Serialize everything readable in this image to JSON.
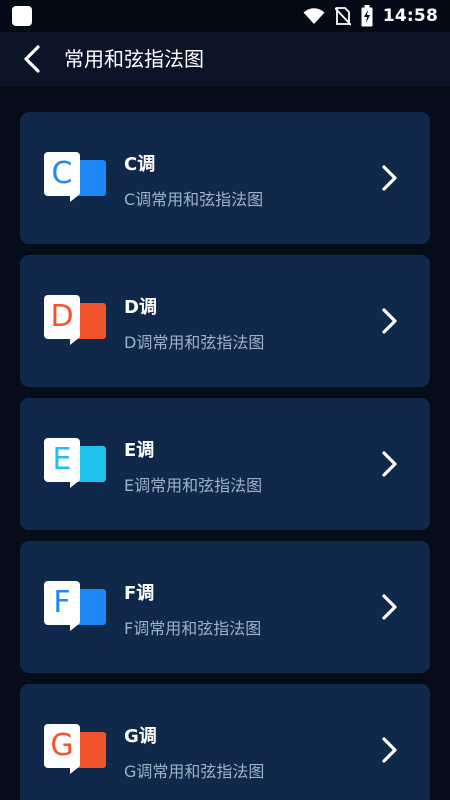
{
  "status_bar": {
    "time": "14:58",
    "icons": [
      "app-notification-icon",
      "wifi-icon",
      "no-sim-icon",
      "battery-charging-icon"
    ]
  },
  "header": {
    "title": "常用和弦指法图",
    "back_icon": "chevron-left-icon"
  },
  "items": [
    {
      "letter": "C",
      "title": "C调",
      "subtitle": "C调常用和弦指法图",
      "color": "#1e88f5"
    },
    {
      "letter": "D",
      "title": "D调",
      "subtitle": "D调常用和弦指法图",
      "color": "#f2542d"
    },
    {
      "letter": "E",
      "title": "E调",
      "subtitle": "E调常用和弦指法图",
      "color": "#1ec1ea"
    },
    {
      "letter": "F",
      "title": "F调",
      "subtitle": "F调常用和弦指法图",
      "color": "#1e88f5"
    },
    {
      "letter": "G",
      "title": "G调",
      "subtitle": "G调常用和弦指法图",
      "color": "#f2542d"
    }
  ],
  "colors": {
    "background": "#050d1a",
    "card": "#10294a",
    "subtitle_text": "#9fb1c9"
  }
}
